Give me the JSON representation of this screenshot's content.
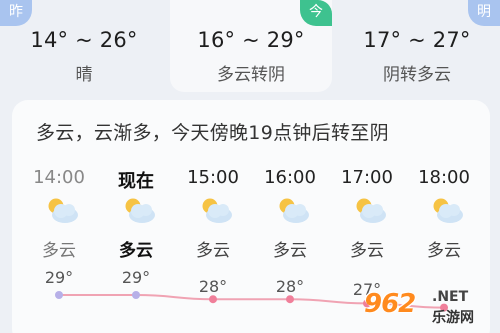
{
  "days": [
    {
      "badge": "昨",
      "temp": "14° ~ 26°",
      "cond": "晴"
    },
    {
      "badge": "今",
      "temp": "16° ~ 29°",
      "cond": "多云转阴"
    },
    {
      "badge": "明",
      "temp": "17° ~ 27°",
      "cond": "阴转多云"
    }
  ],
  "summary": "多云，云渐多，今天傍晚19点钟后转至阴",
  "hourly": [
    {
      "time": "14:00",
      "icon": "partly-cloudy-icon",
      "cond": "多云",
      "temp": "29°",
      "temp_value": 29
    },
    {
      "time": "现在",
      "icon": "partly-cloudy-icon",
      "cond": "多云",
      "temp": "29°",
      "temp_value": 29
    },
    {
      "time": "15:00",
      "icon": "partly-cloudy-icon",
      "cond": "多云",
      "temp": "28°",
      "temp_value": 28
    },
    {
      "time": "16:00",
      "icon": "partly-cloudy-icon",
      "cond": "多云",
      "temp": "28°",
      "temp_value": 28
    },
    {
      "time": "17:00",
      "icon": "partly-cloudy-icon",
      "cond": "多云",
      "temp": "27°",
      "temp_value": 27
    },
    {
      "time": "18:00",
      "icon": "partly-cloudy-icon",
      "cond": "多云",
      "temp": "",
      "temp_value": 26
    }
  ],
  "watermark": {
    "logo": "962",
    "net": ".NET",
    "text": "乐游网"
  },
  "colors": {
    "curve": "#f0a3b3",
    "past_dot": "#b7b0e8",
    "future_dot": "#f07f9a",
    "today_badge": "#3ec28f",
    "other_badge": "#a9c4ef"
  }
}
